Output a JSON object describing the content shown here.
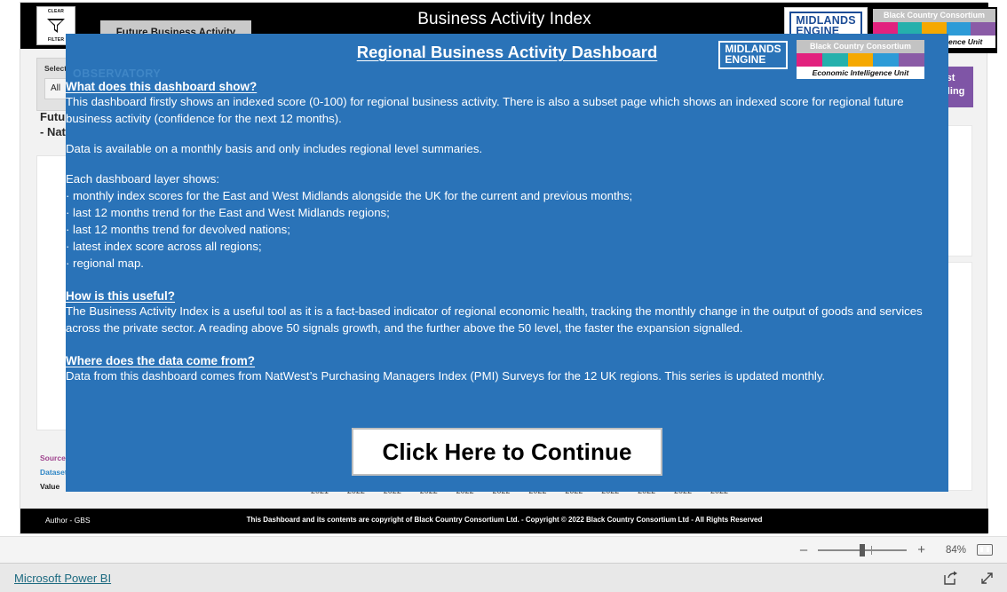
{
  "report": {
    "title": "Business Activity Index",
    "page_tab": "Future Business Activity",
    "clear_filter": {
      "top": "CLEAR",
      "bottom": "FILTER",
      "icon": "filter-funnel-icon"
    },
    "slicer": {
      "label": "Select",
      "value": "All"
    },
    "left_headline": "Future Business\n- Nat",
    "meta": {
      "source": "Source",
      "dataset": "Dataset",
      "value": "Value"
    },
    "purple_card": "Latest\nReading",
    "axis_years": [
      "2021",
      "2022",
      "2022",
      "2022",
      "2022",
      "2022",
      "2022",
      "2022",
      "2022",
      "2022",
      "2022",
      "2022"
    ],
    "footer": {
      "author": "Author - GBS",
      "copyright": "This Dashboard and its contents are copyright of Black Country Consortium Ltd.  -  Copyright © 2022 Black Country Consortium Ltd - All Rights Reserved"
    },
    "logos": {
      "midlands_engine": {
        "line1": "MIDLANDS",
        "line2": "ENGINE"
      },
      "bcc": {
        "top": "Black Country Consortium",
        "bottom": "Economic Intelligence Unit",
        "swatches": [
          "#e2217e",
          "#25b0ac",
          "#f5a800",
          "#2d9bd7",
          "#8a5ba6"
        ]
      }
    }
  },
  "modal": {
    "title": "Regional Business Activity Dashboard",
    "observatory": "OBSERVATORY",
    "sections": [
      {
        "heading": "What does this dashboard show?",
        "paragraphs": [
          "This dashboard firstly shows an indexed score (0-100) for regional business activity. There is also a subset page which shows an indexed score for regional future business activity (confidence for the next 12 months)."
        ]
      },
      {
        "heading": "",
        "paragraphs": [
          "Data is available on a monthly basis and only includes regional level summaries."
        ]
      },
      {
        "heading": "",
        "paragraphs": [
          "Each dashboard layer shows:"
        ],
        "bullets": [
          "·  monthly index scores for the East and West Midlands alongside the UK for the current and previous months;",
          "· last 12 months trend for the East and West Midlands regions;",
          "· last 12 months trend for devolved nations;",
          "· latest index score across all regions;",
          "· regional map."
        ]
      },
      {
        "heading": "How is this useful?",
        "paragraphs": [
          "The Business Activity Index is a useful tool as it is a fact-based indicator of regional economic health, tracking the monthly change in the output of goods and services across the private sector. A reading above 50 signals growth, and the further above the 50 level, the faster the expansion signalled."
        ]
      },
      {
        "heading": "Where does the data come from?",
        "paragraphs": [
          "Data from this dashboard comes from NatWest’s Purchasing Managers Index (PMI) Surveys for the 12 UK regions. This series is updated monthly."
        ]
      }
    ],
    "continue_button": "Click Here to Continue",
    "accent_color": "#2a73b8"
  },
  "zoombar": {
    "minus": "–",
    "plus": "+",
    "percent": "84%",
    "fit_icon": "fit-to-page-icon"
  },
  "statusbar": {
    "link": "Microsoft Power BI",
    "share_icon": "share-icon",
    "fullscreen_icon": "fullscreen-icon"
  }
}
